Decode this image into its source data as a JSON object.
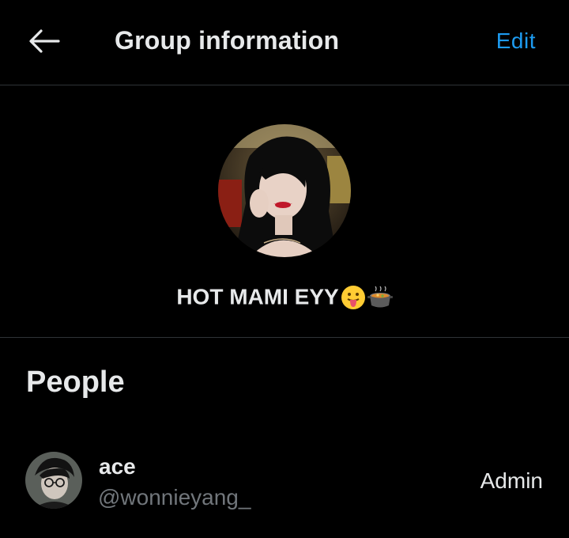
{
  "header": {
    "back_icon": "arrow-left-icon",
    "title": "Group information",
    "edit_label": "Edit"
  },
  "group": {
    "avatar_icon": "group-avatar-photo",
    "name": "HOT MAMI EYY",
    "name_emojis": [
      "tongue-out-face-emoji",
      "pot-of-food-emoji"
    ]
  },
  "people": {
    "heading": "People",
    "members": [
      {
        "avatar_icon": "member-avatar-photo",
        "name": "ace",
        "handle": "@wonnieyang_",
        "role": "Admin"
      }
    ]
  },
  "colors": {
    "background": "#000000",
    "text_primary": "#e7e9ea",
    "text_secondary": "#71767b",
    "accent": "#1d9bf0",
    "divider": "#2f3336"
  }
}
